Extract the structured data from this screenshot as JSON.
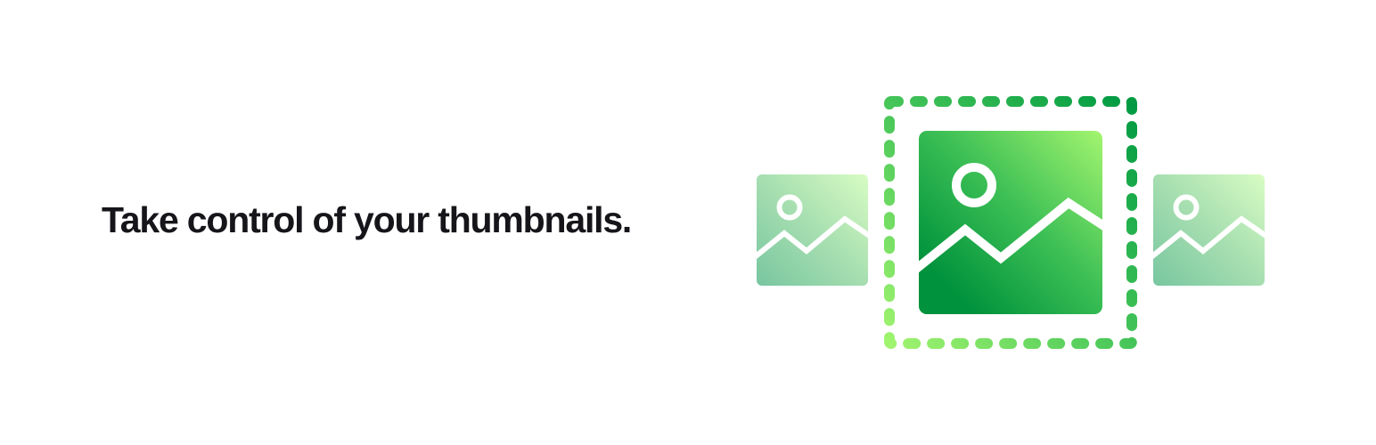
{
  "banner": {
    "tagline": "Take control of your thumbnails."
  },
  "illustration": {
    "icons": {
      "left_thumbnail": "image-icon",
      "center_thumbnail": "image-icon",
      "right_thumbnail": "image-icon",
      "selection_frame": "dashed-selection-frame"
    },
    "colors": {
      "text": "#15151a",
      "green_dark": "#00923c",
      "green_mid": "#3cbf55",
      "green_light": "#9ff26e",
      "faded_green_dark": "#7ecca3",
      "faded_green_light": "#d6fbc1",
      "background": "#ffffff"
    }
  }
}
